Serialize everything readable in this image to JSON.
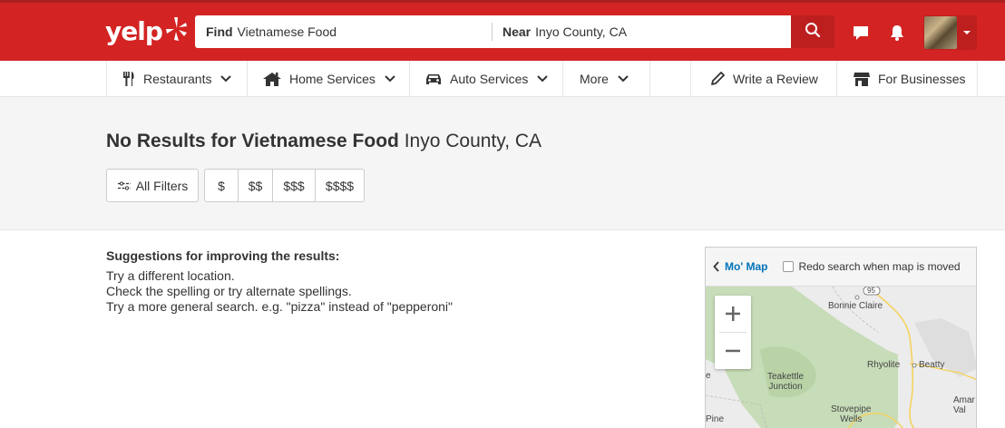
{
  "header": {
    "logo_text": "yelp",
    "search": {
      "find_label": "Find",
      "find_value": "Vietnamese Food",
      "near_label": "Near",
      "near_value": "Inyo County, CA"
    },
    "icons": [
      "search-icon",
      "speech-bubble-icon",
      "bell-icon",
      "avatar",
      "caret-down-icon"
    ]
  },
  "nav": {
    "items": [
      {
        "label": "Restaurants",
        "icon": "fork-knife-icon"
      },
      {
        "label": "Home Services",
        "icon": "house-icon"
      },
      {
        "label": "Auto Services",
        "icon": "car-icon"
      },
      {
        "label": "More",
        "icon": ""
      }
    ],
    "write_review": "Write a Review",
    "for_businesses": "For Businesses"
  },
  "results": {
    "title_bold": "No Results for Vietnamese Food",
    "title_location": "Inyo County, CA",
    "all_filters": "All Filters",
    "prices": [
      "$",
      "$$",
      "$$$",
      "$$$$"
    ]
  },
  "suggestions": {
    "heading": "Suggestions for improving the results:",
    "lines": [
      "Try a different location.",
      "Check the spelling or try alternate spellings.",
      "Try a more general search. e.g. \"pizza\" instead of \"pepperoni\""
    ]
  },
  "map": {
    "back_label": "Mo' Map",
    "redo_label": "Redo search when map is moved",
    "redo_checked": false,
    "zoom_in": "+",
    "zoom_out": "−",
    "labels": {
      "route": "95",
      "bonnie_claire": "Bonnie Claire",
      "rhyolite": "Rhyolite",
      "beatty": "Beatty",
      "teakettle": "Teakettle\nJunction",
      "stovepipe": "Stovepipe\nWells",
      "amargosa": "Amar\nVal",
      "pine": "Pine",
      "edge_e": "e"
    }
  },
  "colors": {
    "brand_red": "#d32323",
    "link_blue": "#0073bb",
    "map_green": "#c7dcb8",
    "road_yellow": "#f4d35e"
  }
}
